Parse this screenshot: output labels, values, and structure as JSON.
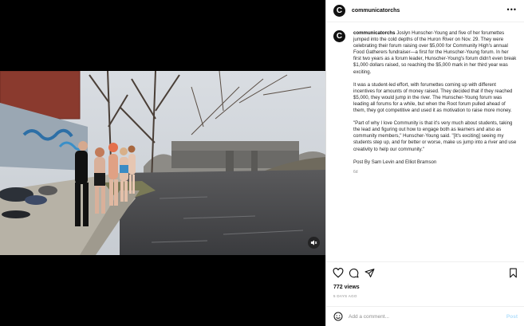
{
  "account": {
    "username": "communicatorchs",
    "avatar_letter": "C"
  },
  "caption": {
    "username": "communicatorchs",
    "paragraphs": [
      "Joslyn Hunscher-Young and five of her forumettes jumped into the cold depths of the Huron River on Nov. 29. They were celebrating their forum raising over $5,000 for Community High's annual Food Gatherers fundraiser—a first for the Hunscher-Young forum. In her first two years as a forum leader, Hunscher-Young's forum didn't even break $1,000 dollars raised, so reaching the $5,000 mark in her third year was exciting.",
      "It was a student-led effort, with forumettes coming up with different incentives for amounts of money raised. They decided that if they reached $5,000, they would jump in the river. The Hunscher-Young forum was leading all forums for a while, but when the Root forum pulled ahead of them, they got competitive and used it as motivation to raise more money.",
      "\"Part of why I love Community is that it's very much about students, taking the lead and figuring out how to engage both as learners and also as community members,\" Hunscher-Young said. \"[It's exciting] seeing my students step up, and for better or worse, make us jump into a river and use creativity to help our community.\"",
      "Post By Sam Levin and Elliot Bramson"
    ],
    "age": "6d"
  },
  "stats": {
    "views": "772 views",
    "posted": "5 DAYS AGO"
  },
  "comment": {
    "placeholder": "Add a comment...",
    "post_label": "Post"
  },
  "icons": {
    "like": "heart-icon",
    "comment": "comment-icon",
    "share": "send-icon",
    "save": "bookmark-icon",
    "more": "more-icon",
    "emoji": "emoji-icon",
    "mute": "muted-speaker-icon"
  },
  "colors": {
    "post_disabled": "#b2dffc",
    "secondary_text": "#8e8e8e"
  }
}
